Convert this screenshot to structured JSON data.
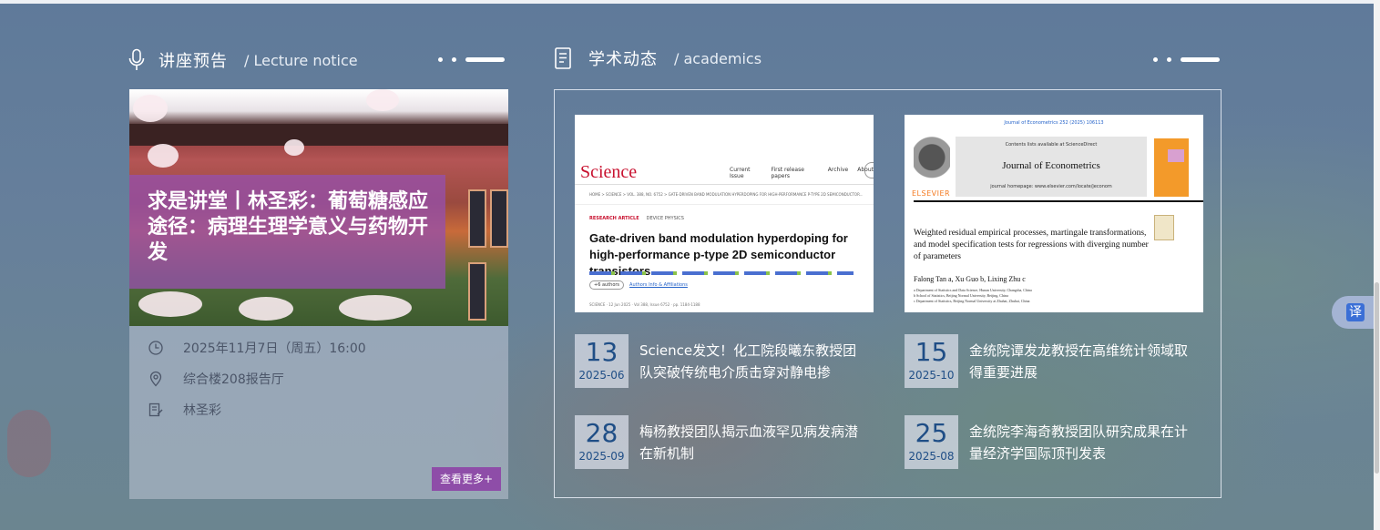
{
  "lecture": {
    "title": "讲座预告",
    "subtitle": "/ Lecture notice",
    "card_title": "求是讲堂丨林圣彩：葡萄糖感应途径：病理生理学意义与药物开发",
    "time": "2025年11月7日（周五）16:00",
    "location": "综合楼208报告厅",
    "speaker": "林圣彩",
    "more_label": "查看更多+"
  },
  "academics": {
    "title": "学术动态",
    "subtitle": "/ academics",
    "shot1": {
      "brand": "Science",
      "nav": [
        "Current Issue",
        "First release papers",
        "Archive",
        "About"
      ],
      "crumb": "HOME  >  SCIENCE  >  VOL. 388, NO. 6752  >  GATE-DRIVEN BAND MODULATION HYPERDOPING FOR HIGH-PERFORMANCE P-TYPE 2D SEMICONDUCTOR...",
      "tag1": "RESEARCH ARTICLE",
      "tag2": "DEVICE PHYSICS",
      "headline": "Gate-driven band modulation hyperdoping for high-performance p-type 2D semiconductor transistors",
      "authors_btn": "+6 authors",
      "authors_link": "Authors Info & Affiliations",
      "footer": "SCIENCE  ·  12 Jun 2025  ·  Vol 388, Issue 6752  ·  pp. 1184-1188"
    },
    "shot2": {
      "citation": "Journal of Econometrics 252 (2025) 106113",
      "contents": "Contents lists available at ScienceDirect",
      "journal": "Journal of Econometrics",
      "homepage": "journal homepage: www.elsevier.com/locate/jeconom",
      "publisher": "ELSEVIER",
      "headline": "Weighted residual empirical processes, martingale transformations, and model specification tests for regressions with diverging number of parameters",
      "authors": "Falong Tan a, Xu Guo b, Lixing Zhu c",
      "aff1": "a Department of Statistics and Data Science, Hunan University, Changsha, China",
      "aff2": "b School of Statistics, Beijing Normal University, Beijing, China",
      "aff3": "c Department of Statistics, Beijing Normal University at Zhuhai, Zhuhai, China"
    },
    "news": [
      {
        "day": "13",
        "ym": "2025-06",
        "title": "Science发文！化工院段曦东教授团队突破传统电介质击穿对静电掺"
      },
      {
        "day": "15",
        "ym": "2025-10",
        "title": "金统院谭发龙教授在高维统计领域取得重要进展"
      },
      {
        "day": "28",
        "ym": "2025-09",
        "title": "梅杨教授团队揭示血液罕见病发病潜在新机制"
      },
      {
        "day": "25",
        "ym": "2025-08",
        "title": "金统院李海奇教授团队研究成果在计量经济学国际顶刊发表"
      }
    ]
  },
  "translate": {
    "label": "译"
  },
  "colors": {
    "purple": "#8e4da8",
    "date_blue": "#1f4e86"
  }
}
